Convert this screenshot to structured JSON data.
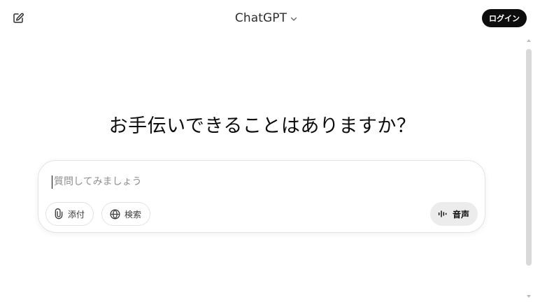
{
  "header": {
    "model_name": "ChatGPT",
    "login_label": "ログイン"
  },
  "main": {
    "headline": "お手伝いできることはありますか？"
  },
  "composer": {
    "placeholder": "質問してみましょう",
    "attach_label": "添付",
    "search_label": "検索",
    "voice_label": "音声"
  },
  "icons": {
    "new_chat": "new-chat-icon",
    "chevron": "chevron-down-icon",
    "attach": "paperclip-icon",
    "search": "globe-icon",
    "voice": "waveform-icon"
  },
  "colors": {
    "primary_button": "#0d0d0d",
    "voice_button_bg": "#ececec",
    "composer_border": "#e3e3e3"
  }
}
